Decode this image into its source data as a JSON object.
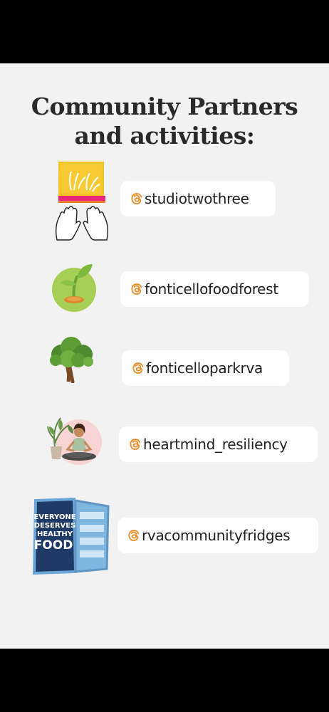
{
  "title_lines": [
    "Community Partners",
    "and activities:"
  ],
  "accent_color": "#f08a24",
  "partners": [
    {
      "handle": "studiotwothree",
      "icon": "hands-painting-icon"
    },
    {
      "handle": "fonticellofoodforest",
      "icon": "sprout-icon"
    },
    {
      "handle": "fonticelloparkrva",
      "icon": "tree-icon"
    },
    {
      "handle": "heartmind_resiliency",
      "icon": "meditation-icon"
    },
    {
      "handle": "rvacommunityfridges",
      "icon": "community-fridge-icon"
    }
  ],
  "fridge_sign_lines": [
    "EVERYONE",
    "DESERVES",
    "HEALTHY",
    "FOOD"
  ]
}
